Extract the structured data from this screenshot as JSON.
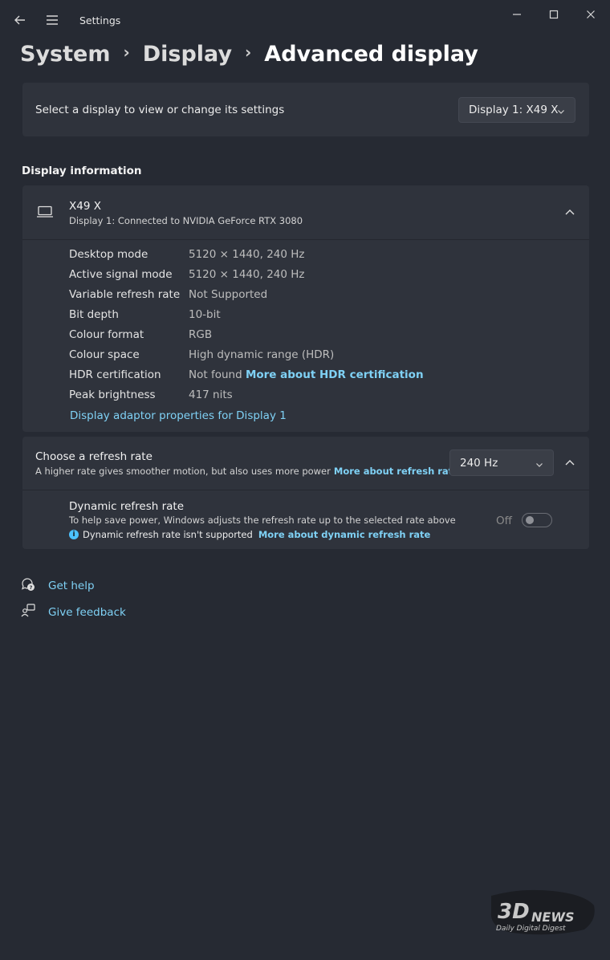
{
  "window": {
    "title": "Settings"
  },
  "breadcrumb": {
    "items": [
      "System",
      "Display",
      "Advanced display"
    ]
  },
  "display_select": {
    "label": "Select a display to view or change its settings",
    "selected": "Display 1: X49 X"
  },
  "display_info": {
    "section_title": "Display information",
    "monitor_name": "X49 X",
    "monitor_connection": "Display 1: Connected to NVIDIA GeForce RTX 3080",
    "rows": [
      {
        "label": "Desktop mode",
        "value": "5120 × 1440, 240 Hz"
      },
      {
        "label": "Active signal mode",
        "value": "5120 × 1440, 240 Hz"
      },
      {
        "label": "Variable refresh rate",
        "value": "Not Supported"
      },
      {
        "label": "Bit depth",
        "value": "10-bit"
      },
      {
        "label": "Colour format",
        "value": "RGB"
      },
      {
        "label": "Colour space",
        "value": "High dynamic range (HDR)"
      },
      {
        "label": "HDR certification",
        "value": "Not found",
        "link": "More about HDR certification"
      },
      {
        "label": "Peak brightness",
        "value": "417 nits"
      }
    ],
    "adaptor_link": "Display adaptor properties for Display 1"
  },
  "refresh_rate": {
    "title": "Choose a refresh rate",
    "description": "A higher rate gives smoother motion, but also uses more power",
    "link": "More about refresh rate",
    "selected": "240 Hz",
    "dynamic": {
      "title": "Dynamic refresh rate",
      "description": "To help save power, Windows adjusts the refresh rate up to the selected rate above",
      "note": "Dynamic refresh rate isn't supported",
      "note_link": "More about dynamic refresh rate",
      "toggle_label": "Off",
      "toggle_on": false
    }
  },
  "help": {
    "get_help": "Get help",
    "give_feedback": "Give feedback"
  },
  "watermark": {
    "brand": "3DNEWS",
    "tagline": "Daily Digital Digest"
  },
  "colors": {
    "background": "#262a33",
    "card": "#2f333c",
    "link": "#7fd1f5",
    "accent": "#4cc2ff"
  }
}
